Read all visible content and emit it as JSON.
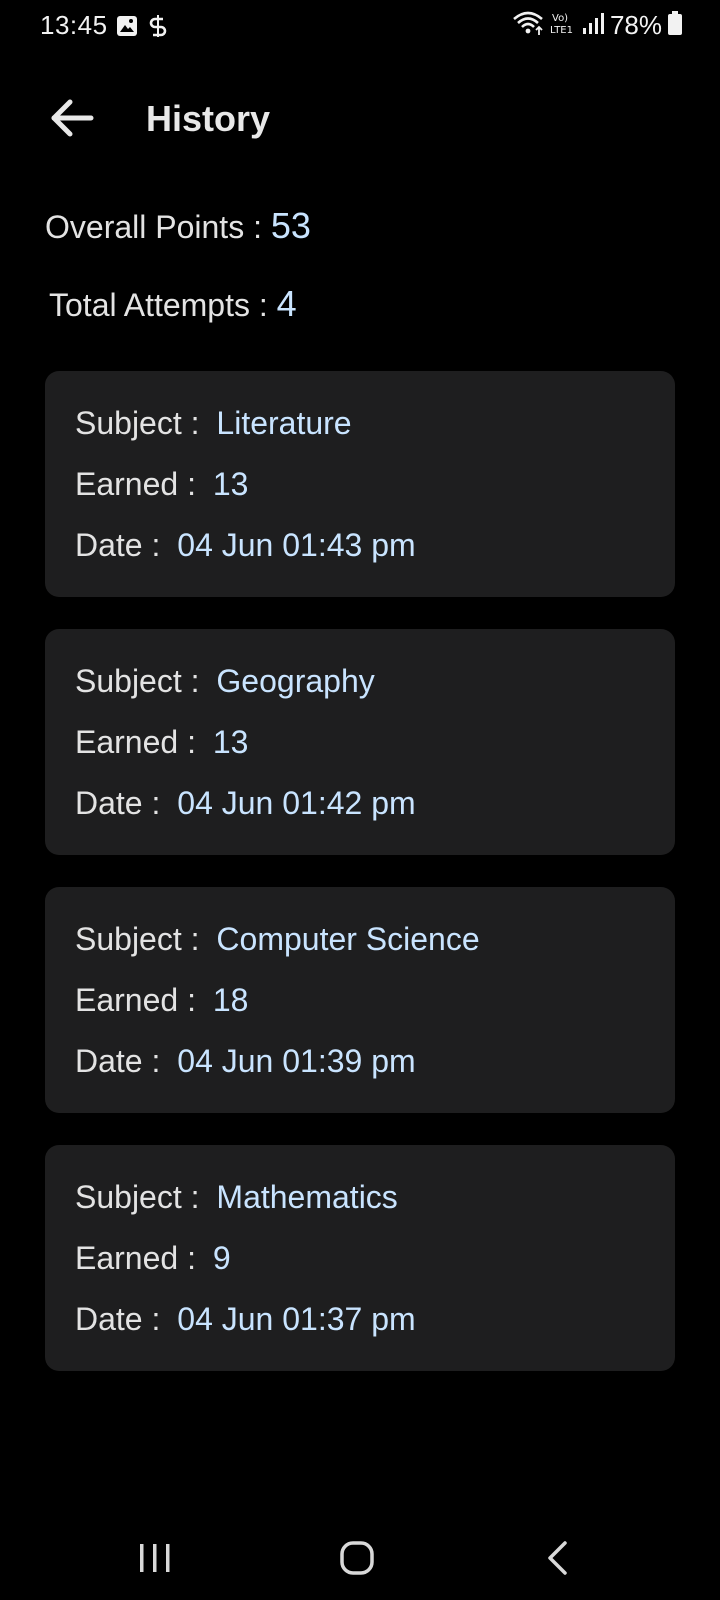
{
  "status_bar": {
    "time": "13:45",
    "battery": "78%",
    "left_icons": [
      "gallery-icon",
      "sync-icon"
    ],
    "right_icons": [
      "wifi-icon",
      "volte-icon",
      "signal-icon",
      "battery-icon"
    ],
    "volte_label": "Vo) LTE1"
  },
  "header": {
    "title": "History",
    "back_icon": "arrow-left-icon"
  },
  "summary": {
    "overall_label": "Overall Points :",
    "overall_value": "53",
    "attempts_label": "Total Attempts :",
    "attempts_value": "4"
  },
  "history": [
    {
      "subject_label": "Subject :",
      "subject": "Literature",
      "earned_label": "Earned :",
      "earned": "13",
      "date_label": "Date :",
      "date": "04 Jun 01:43 pm"
    },
    {
      "subject_label": "Subject :",
      "subject": "Geography",
      "earned_label": "Earned :",
      "earned": "13",
      "date_label": "Date :",
      "date": "04 Jun 01:42 pm"
    },
    {
      "subject_label": "Subject :",
      "subject": "Computer Science",
      "earned_label": "Earned :",
      "earned": "18",
      "date_label": "Date :",
      "date": "04 Jun 01:39 pm"
    },
    {
      "subject_label": "Subject :",
      "subject": "Mathematics",
      "earned_label": "Earned :",
      "earned": "9",
      "date_label": "Date :",
      "date": "04 Jun 01:37 pm"
    }
  ],
  "nav_bar": {
    "icons": [
      "recents-icon",
      "home-icon",
      "back-icon"
    ]
  },
  "colors": {
    "background": "#000000",
    "card": "#1e1e1f",
    "value_text": "#c9e4ff",
    "label_text": "#e3e3e3"
  }
}
